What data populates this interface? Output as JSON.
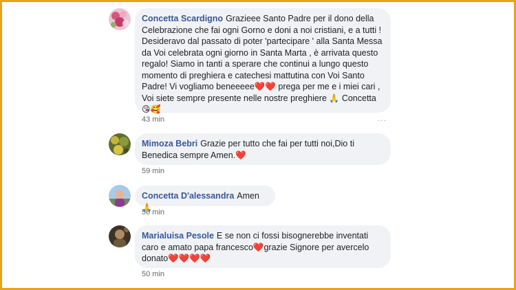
{
  "colors": {
    "frame": "#e8a317",
    "bubble": "#f0f2f5",
    "author": "#385898",
    "heart": "#e0245e",
    "time": "#65676b"
  },
  "comments": [
    {
      "author": "Concetta Scardigno",
      "text_1": "Grazieee Santo Padre per il dono della Celebrazione che fai ogni Gorno e doni a noi cristiani, e a tutti ! Desideravo dal passato di poter 'partecipare ' alla Santa Messa da Voi celebrata ogni giorno in Santa Marta , è arrivata questo regalo! Siamo in tanti a sperare che continui a lungo questo momento di preghiera e catechesi mattutina con Voi Santo Padre! Vi vogliamo beneeeee",
      "hearts": "❤️❤️",
      "text_2": " prega per me e i miei cari , Voi siete sempre presente nelle nostre preghiere ",
      "pray": "🙏",
      "text_3": " Concetta",
      "emoji_end": "😘🥰",
      "time": "43 min",
      "avatar_icon": "flowers-avatar-icon"
    },
    {
      "author": "Mimoza Bebri",
      "text_1": "Grazie per tutto che fai per tutti noi,Dio ti Benedica sempre Amen.",
      "heart": "❤️",
      "time": "59 min",
      "avatar_icon": "garden-avatar-icon"
    },
    {
      "author": "Concetta D'alessandra",
      "text_1": "Amen",
      "pray": "🙏",
      "time": "56 min",
      "avatar_icon": "person-avatar-icon"
    },
    {
      "author": "Marialuisa Pesole",
      "text_1": "E se non ci fossi bisognerebbe inventati caro e amato papa francesco",
      "heart": "❤️",
      "text_2": "grazie Signore per avercelo donato",
      "hearts": "❤️❤️❤️❤️",
      "time": "50 min",
      "avatar_icon": "portrait-avatar-icon"
    }
  ]
}
